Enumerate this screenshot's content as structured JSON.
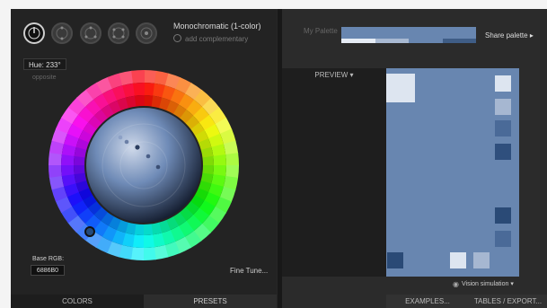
{
  "left_panel": {
    "scheme_title": "Monochromatic (1-color)",
    "add_complementary": "add complementary",
    "scheme_buttons": [
      "mono-icon",
      "triad-icon",
      "tetrad-icon",
      "analogic-icon",
      "accented-icon"
    ],
    "hue_label": "Hue: 233°",
    "opposite_label": "opposite",
    "base_rgb_label": "Base RGB:",
    "base_rgb_value": "6886B0",
    "fine_tune": "Fine Tune..."
  },
  "right_panel": {
    "my_palette_label": "My Palette",
    "share_palette": "Share palette ▸",
    "vision_simulation": "Vision simulation ▾",
    "palette_strip_colors": [
      "#e6ecf5",
      "#a8b9d2",
      "#6886b0",
      "#3f5d86"
    ]
  },
  "tabs": {
    "colors": "COLORS",
    "presets": "PRESETS",
    "preview": "PREVIEW ▾",
    "examples": "EXAMPLES...",
    "tables": "TABLES / EXPORT..."
  },
  "colors": {
    "base": "#6886b0",
    "light1": "#dde5f0",
    "light2": "#a6b7d1",
    "dark1": "#3e5d88",
    "dark2": "#2a4a76"
  }
}
